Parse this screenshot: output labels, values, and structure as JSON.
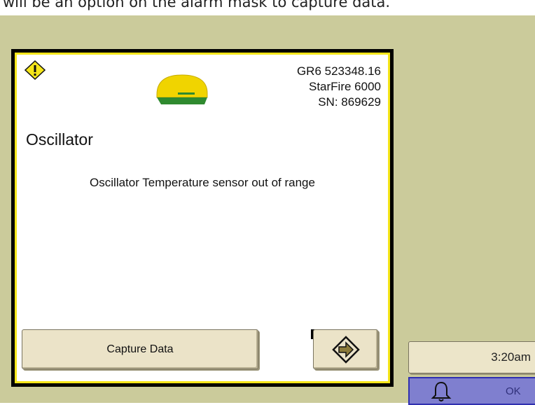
{
  "caption": {
    "text": "will be an option on the alarm mask to capture data."
  },
  "dialog": {
    "device": {
      "line1": "GR6 523348.16",
      "line2": "StarFire 6000",
      "line3": "SN: 869629"
    },
    "title": "Oscillator",
    "message": "Oscillator Temperature sensor out of range",
    "capture_label": "Capture Data",
    "icons": {
      "warning": "warning-triangle-icon",
      "receiver": "starfire-receiver-icon",
      "next": "arrow-right-icon"
    },
    "colors": {
      "frame": "#000000",
      "border": "#f5e61a",
      "background": "#ffffff"
    }
  },
  "status": {
    "time": "3:20am",
    "ok_label": "OK"
  },
  "colors": {
    "screen_bg": "#cbcb9b",
    "button_bg": "#ebe3c8",
    "alarm_bg": "#7f7fcf"
  }
}
